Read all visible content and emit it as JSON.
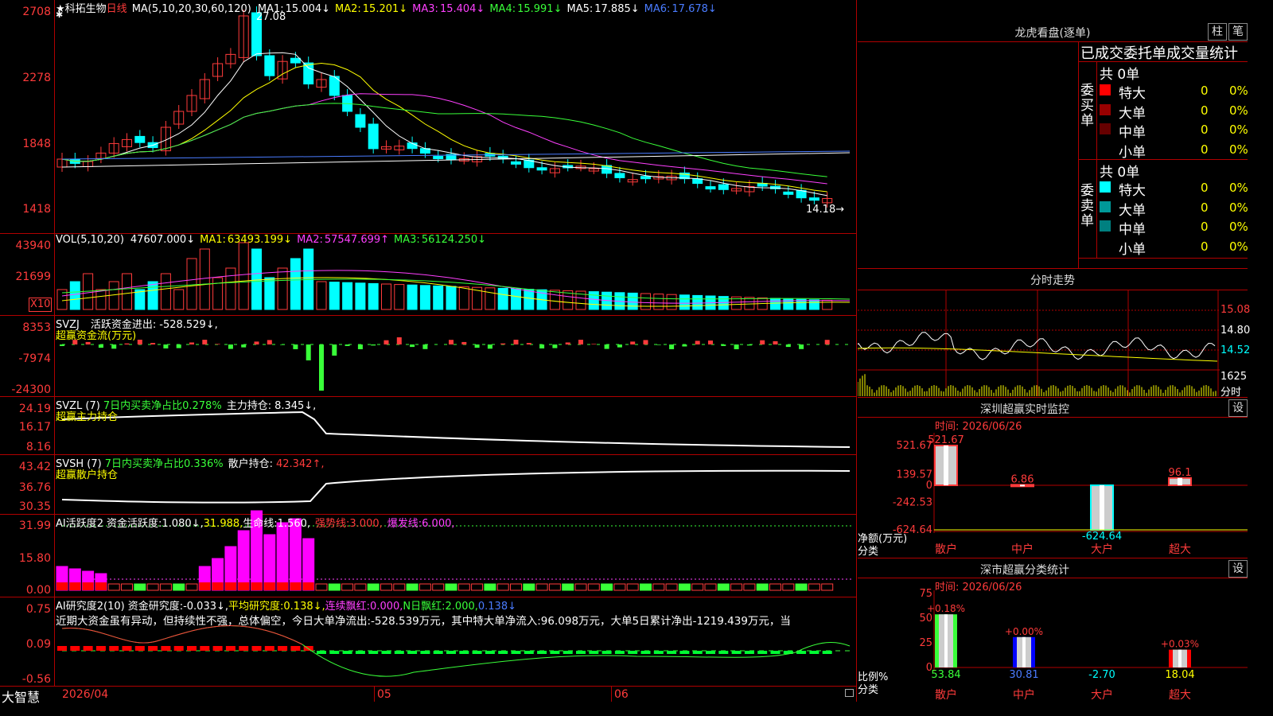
{
  "stock": {
    "star": "★",
    "name": "科拓生物",
    "period": "日线"
  },
  "kline": {
    "ma_header": "MA(5,10,20,30,60,120)",
    "ma": [
      {
        "label": "MA1:",
        "value": "15.004↓",
        "color": "#ffffff"
      },
      {
        "label": "MA2:",
        "value": "15.201↓",
        "color": "#ffff00"
      },
      {
        "label": "MA3:",
        "value": "15.404↓",
        "color": "#ff40ff"
      },
      {
        "label": "MA4:",
        "value": "15.991↓",
        "color": "#39ff39"
      },
      {
        "label": "MA5:",
        "value": "17.885↓",
        "color": "#ffffff"
      },
      {
        "label": "MA6:",
        "value": "17.678↓",
        "color": "#4a7cff"
      }
    ],
    "yticks": [
      "2708",
      "2278",
      "1848",
      "1418"
    ],
    "high_label": "27.08",
    "low_label": "14.18"
  },
  "vol": {
    "header": "VOL(5,10,20)",
    "value": "47607.000↓",
    "ma": [
      {
        "label": "MA1:",
        "value": "63493.199↓",
        "color": "#ffff00"
      },
      {
        "label": "MA2:",
        "value": "57547.699↑",
        "color": "#ff40ff"
      },
      {
        "label": "MA3:",
        "value": "56124.250↓",
        "color": "#39ff39"
      }
    ],
    "yticks": [
      "43940",
      "21699"
    ],
    "unit": "X10"
  },
  "svzj": {
    "header": "SVZJ",
    "label": "活跃资金进出:",
    "value": "-528.529↓,",
    "sub": "超赢资金流(万元)",
    "yticks": [
      "8353",
      "-7974",
      "-24300"
    ]
  },
  "svzl": {
    "header": "SVZL (7)",
    "label1": "7日内买卖净占比0.278%",
    "label2": "主力持仓:",
    "value2": "8.345↓,",
    "sub": "超赢主力持仓",
    "yticks": [
      "24.19",
      "16.17",
      "8.16"
    ]
  },
  "svsh": {
    "header": "SVSH (7)",
    "label1": "7日内买卖净占比0.336%",
    "label2": "散户持仓:",
    "value2": "42.342↑,",
    "sub": "超赢散户持仓",
    "yticks": [
      "43.42",
      "36.76",
      "30.35"
    ]
  },
  "ai_active": {
    "header": "AI活跃度2",
    "l1": "资金活跃度:",
    "v1": "1.080↓,",
    "v1b": "31.988,",
    "l2": "生命线:",
    "v2": "1.560,",
    "l3": "强势线:",
    "v3": "3.000,",
    "l4": "爆发线:",
    "v4": "6.000,",
    "yticks": [
      "31.99",
      "15.80",
      "0.00"
    ]
  },
  "ai_research": {
    "header": "AI研究度2(10)",
    "l1": "资金研究度:",
    "v1": "-0.033↓,",
    "l2": "平均研究度:",
    "v2": "0.138↓,",
    "l3": "连续飘红:",
    "v3": "0.000,",
    "l4": "N日飘红:",
    "v4": "2.000,",
    "v5": "0.138↓",
    "comment": "近期大资金虽有异动，但持续性不强，总体偏空，今日大单净流出:-528.539万元，其中特大单净流入:96.098万元，大单5日累计净出-1219.439万元，当",
    "yticks": [
      "0.75",
      "0.09",
      "-0.56"
    ]
  },
  "bottom": {
    "brand": "大智慧",
    "date": "2026/04",
    "m1": "05",
    "m2": "06"
  },
  "longhu": {
    "title": "龙虎看盘(逐单)",
    "btn1": "柱",
    "btn2": "笔",
    "subtitle": "已成交委托单成交量统计",
    "buy_label": "委买单",
    "sell_label": "委卖单",
    "buy_total": "共 0单",
    "sell_total": "共 0单",
    "buy_rows": [
      {
        "name": "特大",
        "count": "0",
        "pct": "0%",
        "color": "#ff0000"
      },
      {
        "name": "大单",
        "count": "0",
        "pct": "0%",
        "color": "#990000"
      },
      {
        "name": "中单",
        "count": "0",
        "pct": "0%",
        "color": "#660000"
      },
      {
        "name": "小单",
        "count": "0",
        "pct": "0%",
        "color": ""
      }
    ],
    "sell_rows": [
      {
        "name": "特大",
        "count": "0",
        "pct": "0%",
        "color": "#00ffff"
      },
      {
        "name": "大单",
        "count": "0",
        "pct": "0%",
        "color": "#009999"
      },
      {
        "name": "中单",
        "count": "0",
        "pct": "0%",
        "color": "#008080"
      },
      {
        "name": "小单",
        "count": "0",
        "pct": "0%",
        "color": ""
      }
    ]
  },
  "fenshi": {
    "title": "分时走势",
    "yticks": [
      "15.08",
      "14.80",
      "14.52"
    ],
    "vol_label": "1625",
    "tag": "分时"
  },
  "sz_monitor": {
    "title": "深圳超赢实时监控",
    "btn": "设",
    "time": "时间: 2026/06/26",
    "yticks": [
      "521.67",
      "139.57",
      "0",
      "-242.53",
      "-624.64"
    ],
    "ylabel": "净额(万元)",
    "xlabel": "分类",
    "cats": [
      "散户",
      "中户",
      "大户",
      "超大"
    ]
  },
  "sz_class": {
    "title": "深市超赢分类统计",
    "btn": "设",
    "time": "时间: 2026/06/26",
    "yticks": [
      "75",
      "50",
      "25",
      "0"
    ],
    "ylabel": "比例%",
    "xlabel": "分类",
    "cats": [
      "散户",
      "中户",
      "大户",
      "超大"
    ]
  },
  "chart_data": [
    {
      "type": "bar",
      "title": "深圳超赢实时监控",
      "ylabel": "净额(万元)",
      "categories": [
        "散户",
        "中户",
        "大户",
        "超大"
      ],
      "values": [
        521.67,
        6.86,
        -624.64,
        96.1
      ],
      "ylim": [
        -624.64,
        521.67
      ]
    },
    {
      "type": "bar",
      "title": "深市超赢分类统计",
      "ylabel": "比例%",
      "categories": [
        "散户",
        "中户",
        "大户",
        "超大"
      ],
      "values": [
        53.84,
        30.81,
        -2.7,
        18.04
      ],
      "top_labels": [
        "+0.18%",
        "+0.00%",
        "",
        "+0.03%"
      ],
      "ylim": [
        0,
        75
      ]
    }
  ]
}
